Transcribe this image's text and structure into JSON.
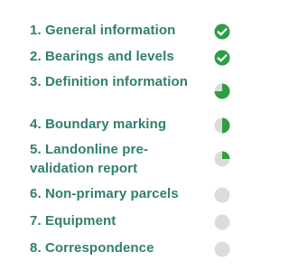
{
  "colors": {
    "label": "#2f7f6f",
    "complete": "#2e9e45",
    "pending": "#dcdcdc"
  },
  "steps": [
    {
      "label": "1. General information",
      "status": "complete",
      "progress": 1.0,
      "icon": "check-circle-icon"
    },
    {
      "label": "2. Bearings and levels",
      "status": "complete",
      "progress": 1.0,
      "icon": "check-circle-icon"
    },
    {
      "label": "3. Definition information",
      "status": "in-progress",
      "progress": 0.75,
      "icon": "progress-pie-icon"
    },
    {
      "label": "4. Boundary marking",
      "status": "in-progress",
      "progress": 0.5,
      "icon": "progress-pie-icon"
    },
    {
      "label": "5. Landonline pre-validation report",
      "status": "in-progress",
      "progress": 0.25,
      "icon": "progress-pie-icon"
    },
    {
      "label": "6. Non-primary parcels",
      "status": "not-started",
      "progress": 0,
      "icon": "empty-circle-icon"
    },
    {
      "label": "7. Equipment",
      "status": "not-started",
      "progress": 0,
      "icon": "empty-circle-icon"
    },
    {
      "label": "8. Correspondence",
      "status": "not-started",
      "progress": 0,
      "icon": "empty-circle-icon"
    }
  ]
}
